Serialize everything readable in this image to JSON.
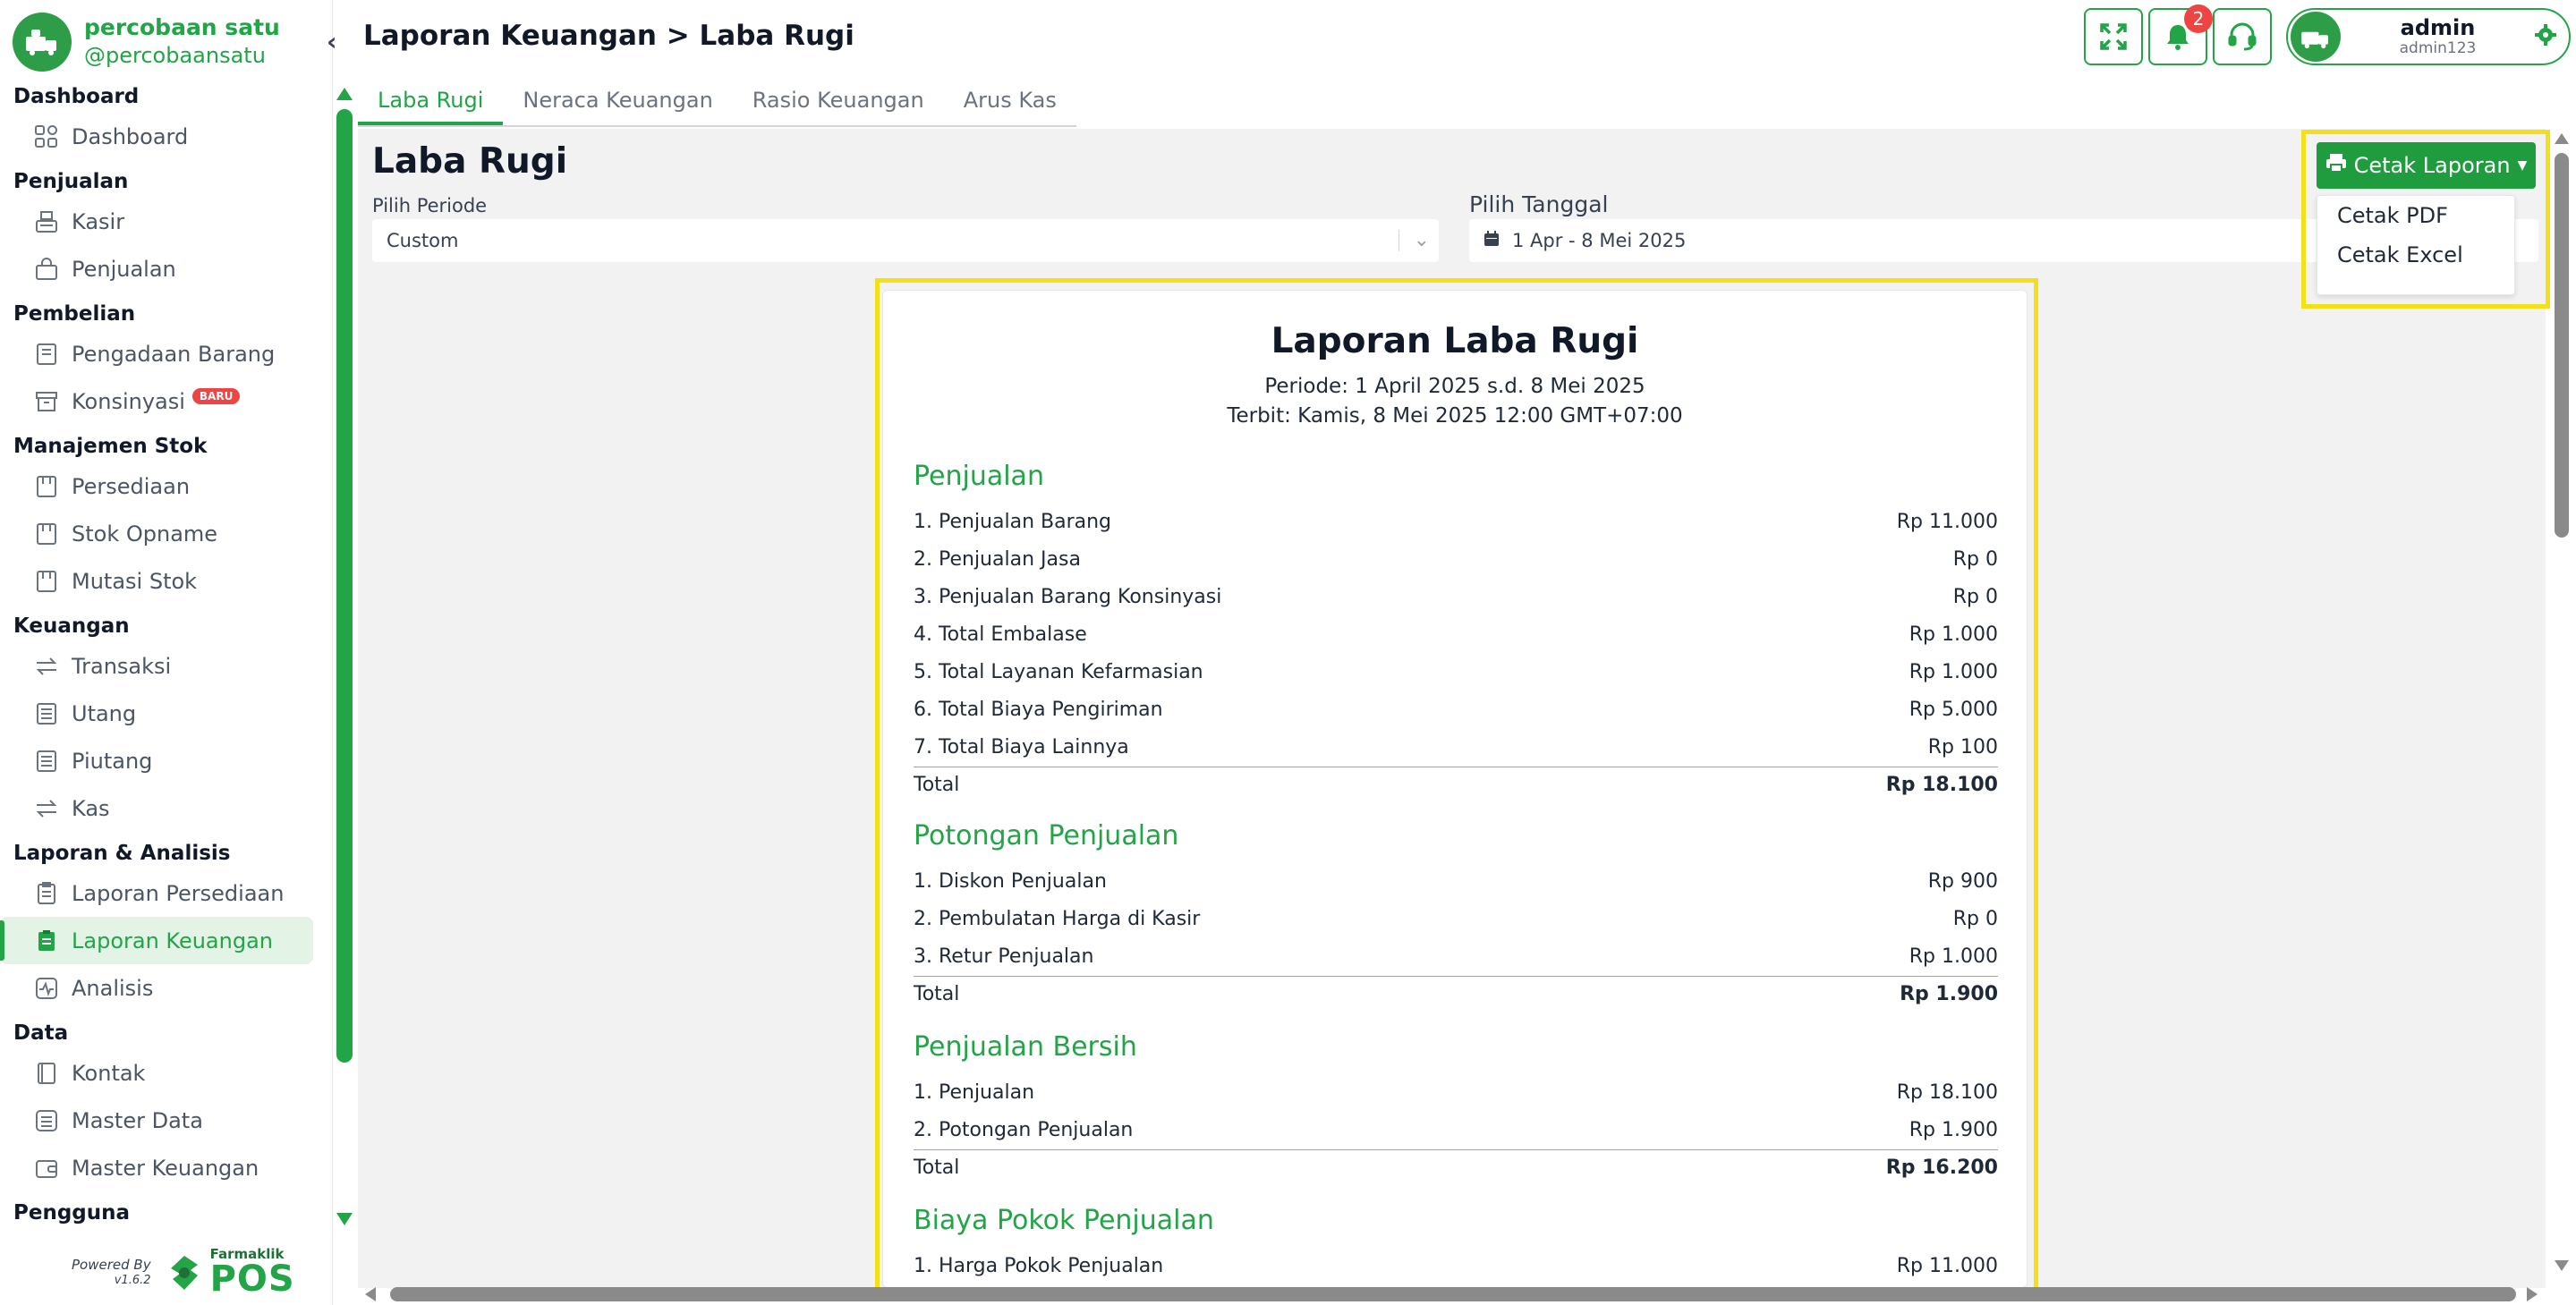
{
  "brand": {
    "name": "percobaan satu",
    "username": "@percobaansatu"
  },
  "colors": {
    "primary": "#22a447",
    "highlight": "#f3e017",
    "badge": "#ef4444"
  },
  "sidebar": {
    "groups": [
      {
        "heading": "Dashboard",
        "items": [
          {
            "label": "Dashboard",
            "icon": "grid-icon"
          }
        ]
      },
      {
        "heading": "Penjualan",
        "items": [
          {
            "label": "Kasir",
            "icon": "cash-register-icon"
          },
          {
            "label": "Penjualan",
            "icon": "bag-icon"
          }
        ]
      },
      {
        "heading": "Pembelian",
        "items": [
          {
            "label": "Pengadaan Barang",
            "icon": "receipt-icon"
          },
          {
            "label": "Konsinyasi",
            "icon": "archive-icon",
            "badge": "BARU"
          }
        ]
      },
      {
        "heading": "Manajemen Stok",
        "items": [
          {
            "label": "Persediaan",
            "icon": "box-icon"
          },
          {
            "label": "Stok Opname",
            "icon": "box-icon"
          },
          {
            "label": "Mutasi Stok",
            "icon": "box-icon"
          }
        ]
      },
      {
        "heading": "Keuangan",
        "items": [
          {
            "label": "Transaksi",
            "icon": "transfer-icon"
          },
          {
            "label": "Utang",
            "icon": "document-icon"
          },
          {
            "label": "Piutang",
            "icon": "document-icon"
          },
          {
            "label": "Kas",
            "icon": "transfer-icon"
          }
        ]
      },
      {
        "heading": "Laporan & Analisis",
        "items": [
          {
            "label": "Laporan Persediaan",
            "icon": "clipboard-icon"
          },
          {
            "label": "Laporan Keuangan",
            "icon": "clipboard-icon",
            "active": true
          },
          {
            "label": "Analisis",
            "icon": "activity-icon"
          }
        ]
      },
      {
        "heading": "Data",
        "items": [
          {
            "label": "Kontak",
            "icon": "contact-book-icon"
          },
          {
            "label": "Master Data",
            "icon": "list-icon"
          },
          {
            "label": "Master Keuangan",
            "icon": "wallet-icon"
          }
        ]
      },
      {
        "heading": "Pengguna",
        "items": []
      }
    ],
    "powered_by": "Powered By",
    "version": "v1.6.2",
    "product_small": "Farmaklik",
    "product_big": "POS"
  },
  "header": {
    "title": "Laporan Keuangan > Laba Rugi",
    "notification_count": "2",
    "user_name": "admin",
    "user_id": "admin123"
  },
  "tabs": [
    "Laba Rugi",
    "Neraca Keuangan",
    "Rasio Keuangan",
    "Arus Kas"
  ],
  "page": {
    "title": "Laba Rugi",
    "periode_label": "Pilih Periode",
    "periode_value": "Custom",
    "tanggal_label": "Pilih Tanggal",
    "tanggal_value": "1 Apr - 8 Mei 2025",
    "print_button": "Cetak Laporan",
    "print_options": [
      "Cetak PDF",
      "Cetak Excel"
    ]
  },
  "report": {
    "title": "Laporan Laba Rugi",
    "periode": "Periode: 1 April 2025 s.d. 8 Mei 2025",
    "terbit": "Terbit: Kamis, 8 Mei 2025 12:00 GMT+07:00",
    "sections": [
      {
        "title": "Penjualan",
        "rows": [
          {
            "label": "1. Penjualan Barang",
            "value": "Rp 11.000"
          },
          {
            "label": "2. Penjualan Jasa",
            "value": "Rp 0"
          },
          {
            "label": "3. Penjualan Barang Konsinyasi",
            "value": "Rp 0"
          },
          {
            "label": "4. Total Embalase",
            "value": "Rp 1.000"
          },
          {
            "label": "5. Total Layanan Kefarmasian",
            "value": "Rp 1.000"
          },
          {
            "label": "6. Total Biaya Pengiriman",
            "value": "Rp 5.000"
          },
          {
            "label": "7. Total Biaya Lainnya",
            "value": "Rp 100"
          }
        ],
        "total_label": "Total",
        "total_value": "Rp 18.100"
      },
      {
        "title": "Potongan Penjualan",
        "rows": [
          {
            "label": "1. Diskon Penjualan",
            "value": "Rp 900"
          },
          {
            "label": "2. Pembulatan Harga di Kasir",
            "value": "Rp 0"
          },
          {
            "label": "3. Retur Penjualan",
            "value": "Rp 1.000"
          }
        ],
        "total_label": "Total",
        "total_value": "Rp 1.900"
      },
      {
        "title": "Penjualan Bersih",
        "rows": [
          {
            "label": "1. Penjualan",
            "value": "Rp 18.100"
          },
          {
            "label": "2. Potongan Penjualan",
            "value": "Rp 1.900"
          }
        ],
        "total_label": "Total",
        "total_value": "Rp 16.200"
      },
      {
        "title": "Biaya Pokok Penjualan",
        "rows": [
          {
            "label": "1. Harga Pokok Penjualan",
            "value": "Rp 11.000"
          }
        ]
      }
    ]
  }
}
